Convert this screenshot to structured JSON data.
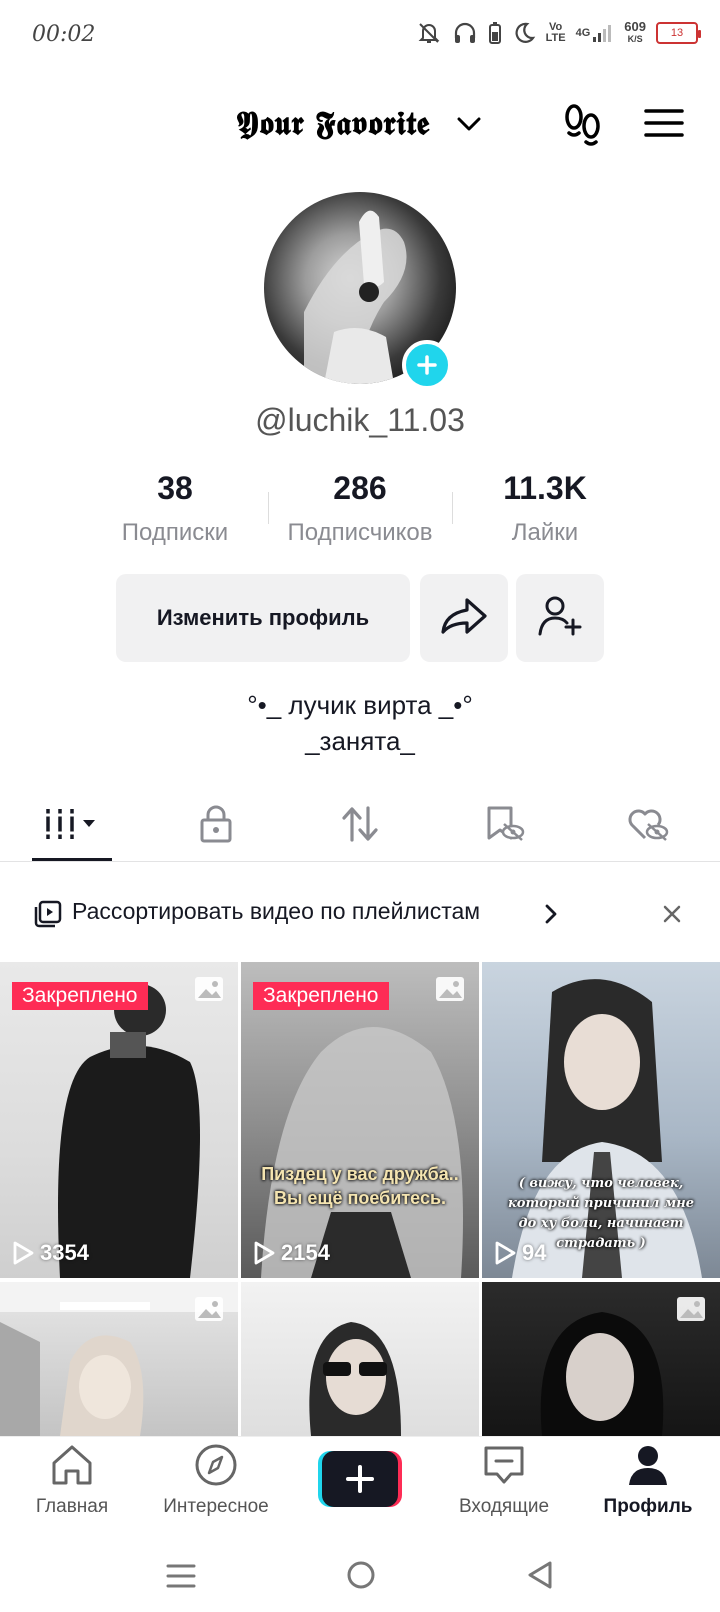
{
  "status_bar": {
    "time": "00:02",
    "network_vo": "Vo",
    "network_lte": "LTE",
    "network_4g": "4G",
    "speed_value": "609",
    "speed_unit": "K/S",
    "battery": "13"
  },
  "header": {
    "account_name": "𝖄𝖔𝖚𝖗 𝕱𝖆𝖛𝖔𝖗𝖎𝖙𝖊",
    "icons": [
      "chevron-down-icon",
      "footprint-icon",
      "hamburger-menu-icon"
    ]
  },
  "profile": {
    "username": "@luchik_11.03",
    "stats": [
      {
        "value": "38",
        "label": "Подписки"
      },
      {
        "value": "286",
        "label": "Подписчиков"
      },
      {
        "value": "11.3K",
        "label": "Лайки"
      }
    ],
    "edit_button": "Изменить профиль",
    "bio_line1": "°•_ лучик вирта _•°",
    "bio_line2": "_занята_"
  },
  "tabs": [
    {
      "name": "videos-grid-icon",
      "selected": true
    },
    {
      "name": "private-lock-icon",
      "selected": false
    },
    {
      "name": "reposts-icon",
      "selected": false
    },
    {
      "name": "favorites-hidden-icon",
      "selected": false
    },
    {
      "name": "liked-hidden-icon",
      "selected": false
    }
  ],
  "playlist_banner": {
    "text": "Рассортировать видео по плейлистам"
  },
  "videos": [
    {
      "pinned": "Закреплено",
      "views": "3354",
      "caption": ""
    },
    {
      "pinned": "Закреплено",
      "views": "2154",
      "caption": "Пиздец у вас дружба.. Вы ещё поебитесь."
    },
    {
      "pinned": "",
      "views": "94",
      "caption": "( вижу, что человек, который причинил мне до ху боли, начинает страдать )"
    },
    {
      "pinned": "",
      "views": "",
      "caption": ""
    },
    {
      "pinned": "",
      "views": "",
      "caption": ""
    },
    {
      "pinned": "",
      "views": "",
      "caption": ""
    }
  ],
  "bottom_nav": [
    {
      "label": "Главная",
      "icon": "home-icon"
    },
    {
      "label": "Интересное",
      "icon": "compass-icon"
    },
    {
      "label": "",
      "icon": "plus-icon"
    },
    {
      "label": "Входящие",
      "icon": "inbox-icon"
    },
    {
      "label": "Профиль",
      "icon": "profile-icon",
      "active": true
    }
  ],
  "colors": {
    "accent_red": "#fe2c55",
    "accent_cyan": "#20d5ec",
    "text_dark": "#161823",
    "text_gray": "#8a8b91"
  }
}
